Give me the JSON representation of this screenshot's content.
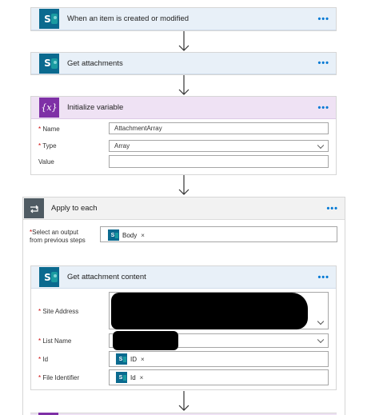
{
  "steps": {
    "trigger": {
      "title": "When an item is created or modified",
      "more": "•••"
    },
    "get_attachments": {
      "title": "Get attachments",
      "more": "•••"
    },
    "init_variable": {
      "title": "Initialize variable",
      "icon_text": "{x}",
      "more": "•••",
      "name_label": "Name",
      "name_value": "AttachmentArray",
      "type_label": "Type",
      "type_value": "Array",
      "value_label": "Value",
      "value_value": ""
    },
    "apply_each": {
      "title": "Apply to each",
      "more": "•••",
      "select_label_1": "Select an output",
      "select_label_2": "from previous steps",
      "token_label": "Body",
      "token_remove": "×"
    },
    "get_content": {
      "title": "Get attachment content",
      "more": "•••",
      "site_label": "Site Address",
      "list_label": "List Name",
      "id_label": "Id",
      "id_token": "ID",
      "file_label": "File Identifier",
      "file_token": "Id",
      "token_remove": "×"
    }
  },
  "required_marker": "*",
  "icons": {
    "sharepoint": "sharepoint-icon",
    "variable": "variable-icon",
    "loop": "loop-icon",
    "chevron": "chevron-down-icon",
    "arrow": "arrow-down-icon"
  },
  "colors": {
    "sharepoint_header": "#e8f0f8",
    "variable_header": "#efe2f4",
    "variable_icon": "#7e30a6",
    "sharepoint_icon": "#0b6a8f",
    "loop_icon": "#4f5b63",
    "more_dots": "#0078d4"
  }
}
